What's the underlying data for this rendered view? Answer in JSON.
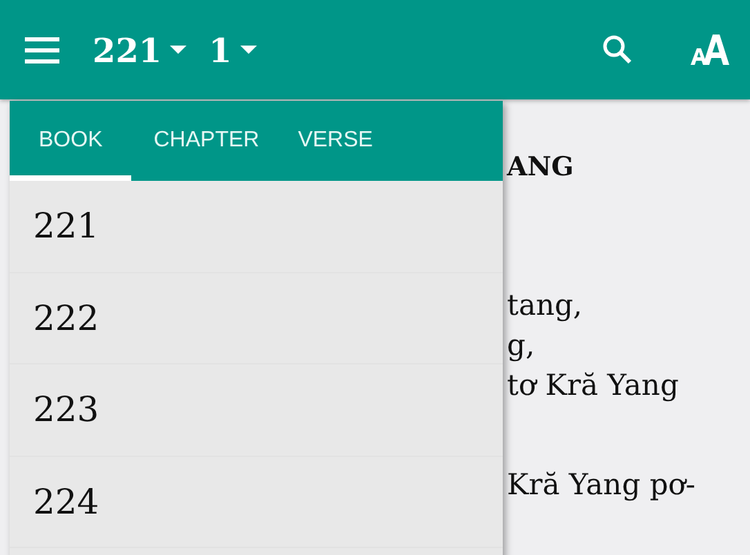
{
  "app_bar": {
    "book": "221",
    "chapter": "1"
  },
  "content": {
    "heading": "ANG",
    "stanzas": [
      [
        "tang,",
        "g,",
        "tơ Kră Yang"
      ],
      [
        "Kră Yang pơ-"
      ]
    ]
  },
  "picker": {
    "tabs": [
      {
        "label": "BOOK",
        "selected": true
      },
      {
        "label": "CHAPTER",
        "selected": false
      },
      {
        "label": "VERSE",
        "selected": false
      }
    ],
    "items": [
      "221",
      "222",
      "223",
      "224"
    ]
  }
}
